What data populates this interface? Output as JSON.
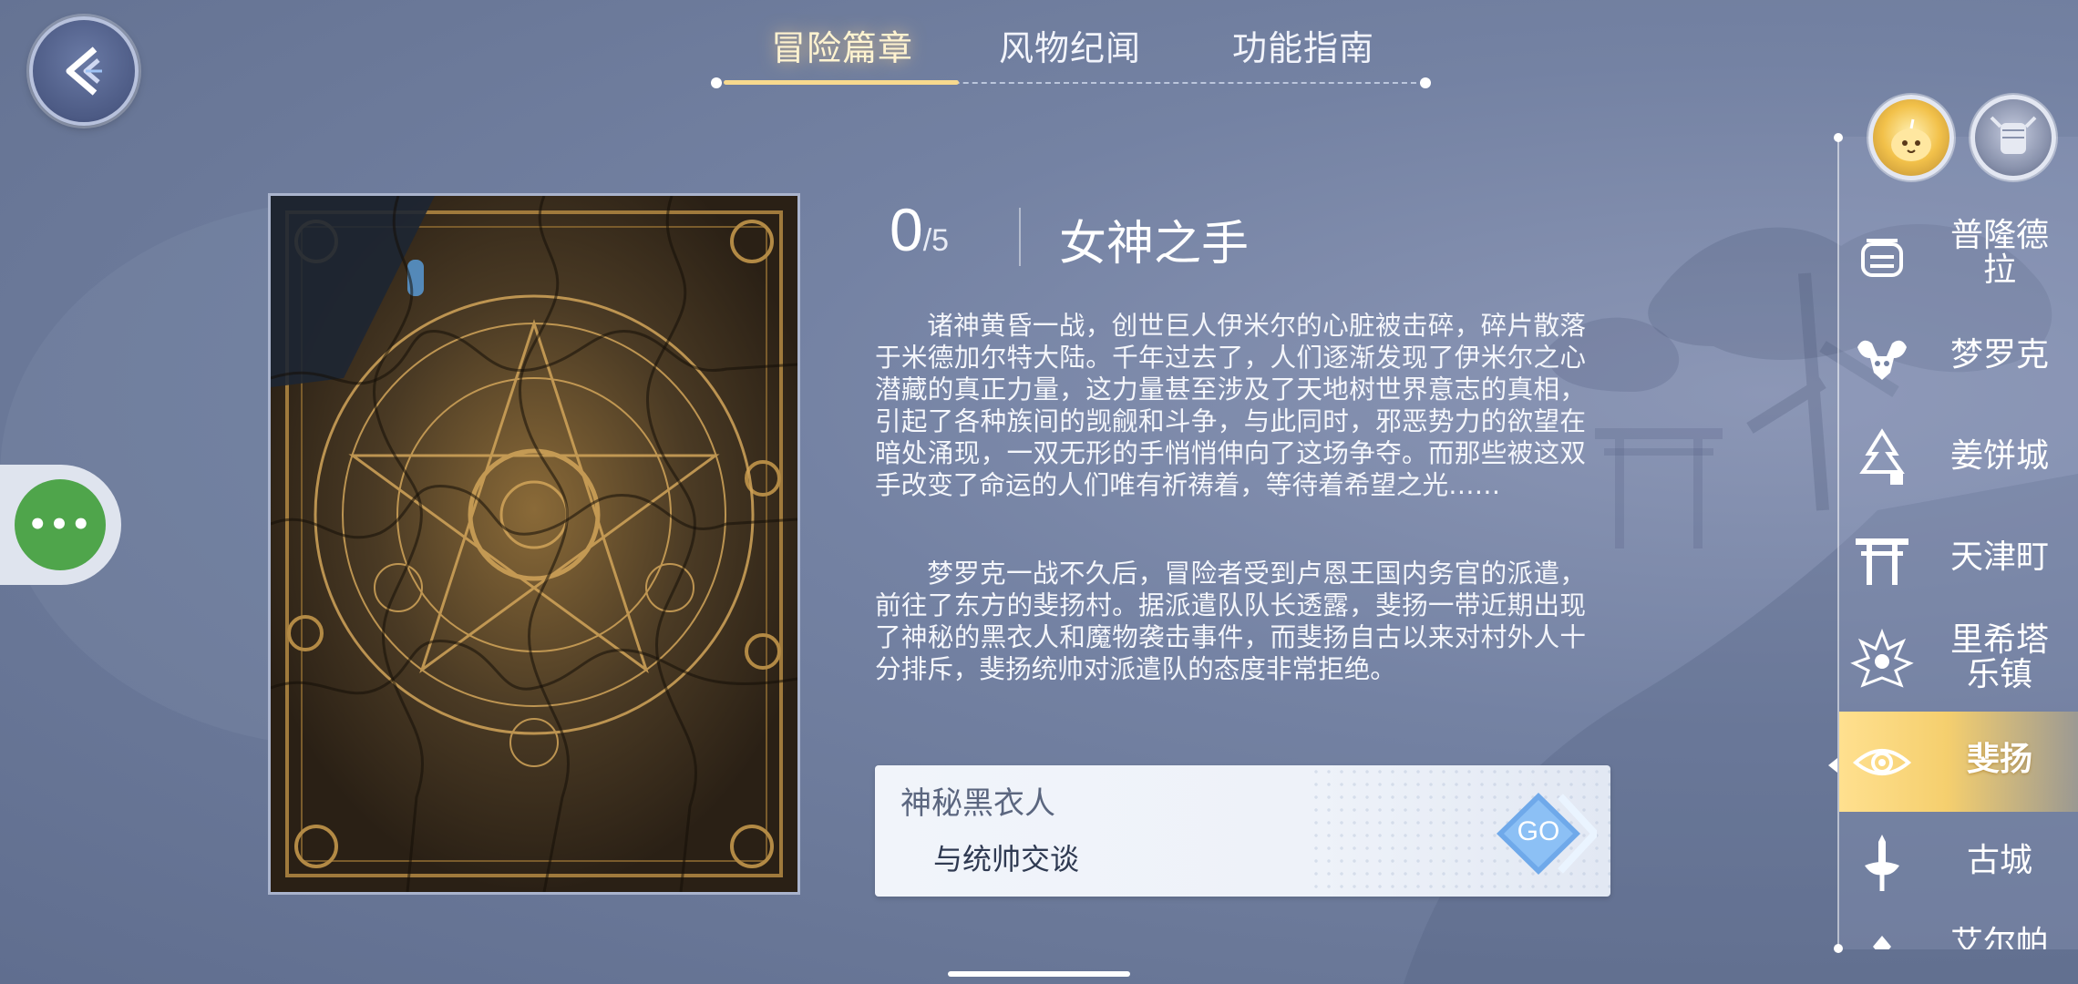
{
  "tabs": [
    {
      "label": "冒险篇章",
      "active": true
    },
    {
      "label": "风物纪闻",
      "active": false
    },
    {
      "label": "功能指南",
      "active": false
    }
  ],
  "progress": {
    "current": "0",
    "total": "/5"
  },
  "chapter": {
    "title": "女神之手",
    "paragraphs": [
      "诸神黄昏一战，创世巨人伊米尔的心脏被击碎，碎片散落于米德加尔特大陆。千年过去了，人们逐渐发现了伊米尔之心潜藏的真正力量，这力量甚至涉及了天地树世界意志的真相，引起了各种族间的觊觎和斗争，与此同时，邪恶势力的欲望在暗处涌现，一双无形的手悄悄伸向了这场争夺。而那些被这双手改变了命运的人们唯有祈祷着，等待着希望之光……",
      "梦罗克一战不久后，冒险者受到卢恩王国内务官的派遣，前往了东方的斐扬村。据派遣队队长透露，斐扬一带近期出现了神秘的黑衣人和魔物袭击事件，而斐扬自古以来对村外人十分排斥，斐扬统帅对派遣队的态度非常拒绝。"
    ]
  },
  "quest": {
    "title": "神秘黑衣人",
    "task": "与统帅交谈",
    "go_label": "GO"
  },
  "more_button": {
    "label": "•••"
  },
  "regions": [
    {
      "label": "普隆德\n拉",
      "icon": "prontera-icon",
      "active": false
    },
    {
      "label": "梦罗克",
      "icon": "morroc-icon",
      "active": false
    },
    {
      "label": "姜饼城",
      "icon": "lutie-icon",
      "active": false
    },
    {
      "label": "天津町",
      "icon": "amatsu-icon",
      "active": false
    },
    {
      "label": "里希塔\n乐镇",
      "icon": "lighthalzen-icon",
      "active": false
    },
    {
      "label": "斐扬",
      "icon": "payon-icon",
      "active": true
    },
    {
      "label": "古城",
      "icon": "glast-heim-icon",
      "active": false
    },
    {
      "label": "艾尔帕",
      "icon": "region-icon",
      "active": false
    }
  ],
  "colors": {
    "accent_gold": "#f7d98e",
    "go_green": "#4fa54b",
    "bg": "#7482a3"
  }
}
